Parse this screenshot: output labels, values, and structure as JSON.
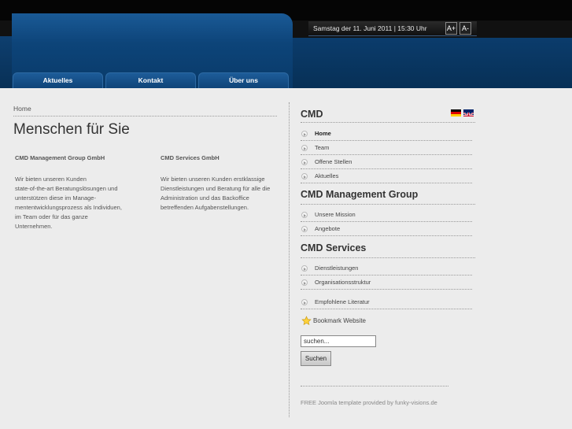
{
  "header": {
    "date_text": "Samstag der 11. Juni 2011  |  15:30 Uhr",
    "font_increase": "A+",
    "font_decrease": "A-"
  },
  "nav": [
    {
      "label": "Aktuelles"
    },
    {
      "label": "Kontakt"
    },
    {
      "label": "Über uns"
    }
  ],
  "breadcrumb": "Home",
  "page_title": "Menschen für Sie",
  "columns": [
    {
      "heading": "CMD Management Group GmbH",
      "lines": [
        "Wir bieten unseren Kunden",
        "state-of-the-art Beratungslösungen und",
        "unterstützen diese im Manage-",
        "mententwicklungsprozess als Individuen,",
        "im Team oder für das ganze",
        "Unternehmen."
      ]
    },
    {
      "heading": "CMD Services GmbH",
      "lines": [
        "Wir bieten unseren Kunden erstklassige",
        "Dienstleistungen und Beratung für alle die",
        "Administration und das Backoffice",
        "betreffenden Aufgabenstellungen."
      ]
    }
  ],
  "sidebar": {
    "section1": {
      "title": "CMD",
      "items": [
        {
          "label": "Home",
          "active": true
        },
        {
          "label": "Team"
        },
        {
          "label": "Offene Stellen"
        },
        {
          "label": "Aktuelles"
        }
      ]
    },
    "section2": {
      "title": "CMD Management Group",
      "items": [
        {
          "label": "Unsere Mission"
        },
        {
          "label": "Angebote"
        }
      ]
    },
    "section3": {
      "title": "CMD Services",
      "items": [
        {
          "label": "Dienstleistungen"
        },
        {
          "label": "Organisationsstruktur"
        },
        {
          "label": "Empfohlene Literatur"
        }
      ]
    },
    "bookmark_label": "Bookmark Website",
    "search_value": "suchen...",
    "search_button": "Suchen"
  },
  "footer": "FREE Joomla template provided by funky-visions.de",
  "colors": {
    "header_blue": "#0d4479",
    "background": "#ececec"
  }
}
